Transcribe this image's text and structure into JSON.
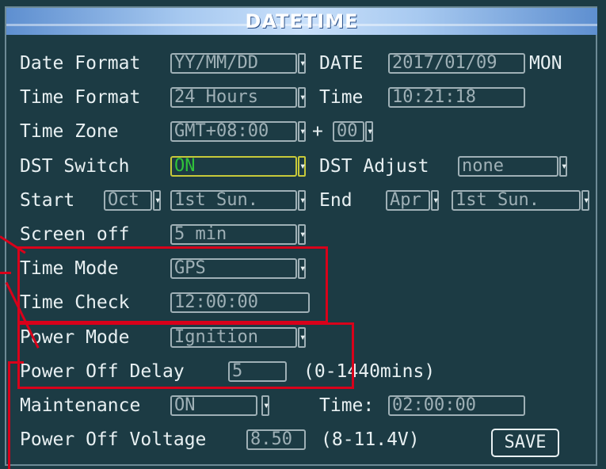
{
  "title": "DATETIME",
  "date": {
    "format_label": "Date Format",
    "format_value": "YY/MM/DD",
    "label": "DATE",
    "value": "2017/01/09",
    "weekday": "MON"
  },
  "time": {
    "format_label": "Time Format",
    "format_value": "24 Hours",
    "label": "Time",
    "value": "10:21:18"
  },
  "timezone": {
    "label": "Time Zone",
    "value": "GMT+08:00",
    "plus": "+",
    "minutes": "00"
  },
  "dst": {
    "switch_label": "DST Switch",
    "switch_value": "ON",
    "adjust_label": "DST Adjust",
    "adjust_value": "none",
    "start_label": "Start",
    "start_month": "Oct",
    "start_week": "1st Sun.",
    "end_label": "End",
    "end_month": "Apr",
    "end_week": "1st Sun."
  },
  "screen_off": {
    "label": "Screen off",
    "value": "5 min"
  },
  "time_mode": {
    "label": "Time Mode",
    "value": "GPS"
  },
  "time_check": {
    "label": "Time Check",
    "value": "12:00:00"
  },
  "power_mode": {
    "label": "Power Mode",
    "value": "Ignition"
  },
  "power_off_delay": {
    "label": "Power Off Delay",
    "value": "5",
    "range": "(0-1440mins)"
  },
  "maintenance": {
    "label": "Maintenance",
    "value": "ON",
    "time_label": "Time:",
    "time_value": "02:00:00"
  },
  "power_off_voltage": {
    "label": "Power Off Voltage",
    "value": "8.50",
    "range": "(8-11.4V)"
  },
  "save_label": "SAVE",
  "colors": {
    "background": "#1c3b44",
    "text": "#e8f0f2",
    "field": "#9fb0b6",
    "active_field": "#30c23a",
    "annotation": "#d8001a"
  }
}
